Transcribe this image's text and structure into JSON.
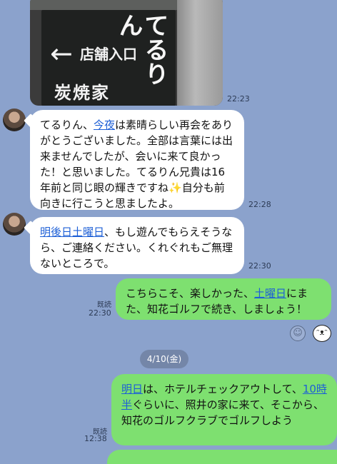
{
  "photo": {
    "arrow": "←",
    "sign_entry": "店舗入口",
    "sign_kana": "てるりん",
    "sign_bottom": "炭焼家"
  },
  "messages": [
    {
      "time": "22:23"
    },
    {
      "segments": [
        {
          "t": "てるりん、"
        },
        {
          "t": "今夜",
          "link": true
        },
        {
          "t": "は素晴らしい再会をありがとうございました。全部は言葉には出来ませんでしたが、会いに来て良かった！と思いました。てるりん兄貴は16年前と同じ眼の輝きですね"
        },
        {
          "t": "✨",
          "em": true
        },
        {
          "t": "自分も前向きに行こうと思ましたよ。"
        }
      ],
      "time": "22:28"
    },
    {
      "segments": [
        {
          "t": "明後日土曜日",
          "link": true
        },
        {
          "t": "、もし遊んでもらえそうなら、ご連絡ください。くれぐれもご無理ないところで。"
        }
      ],
      "time": "22:30"
    },
    {
      "segments": [
        {
          "t": "こちらこそ、楽しかった、"
        },
        {
          "t": "土曜日",
          "link": true
        },
        {
          "t": "にまた、知花ゴルフで続き、しましょう！"
        }
      ],
      "read": "既読",
      "time": "22:30"
    },
    {
      "segments": [
        {
          "t": "明日",
          "link": true
        },
        {
          "t": "は、ホテルチェックアウトして、"
        },
        {
          "t": "10時半",
          "link": true
        },
        {
          "t": "ぐらいに、照井の家に来て、そこから、知花のゴルフクラブでゴルフしよう"
        }
      ],
      "read": "既読",
      "time": "12:38"
    }
  ],
  "date_separator": "4/10(金)",
  "reaction_icon": "☺",
  "sticker_face": "ᵔᴥᵔ"
}
